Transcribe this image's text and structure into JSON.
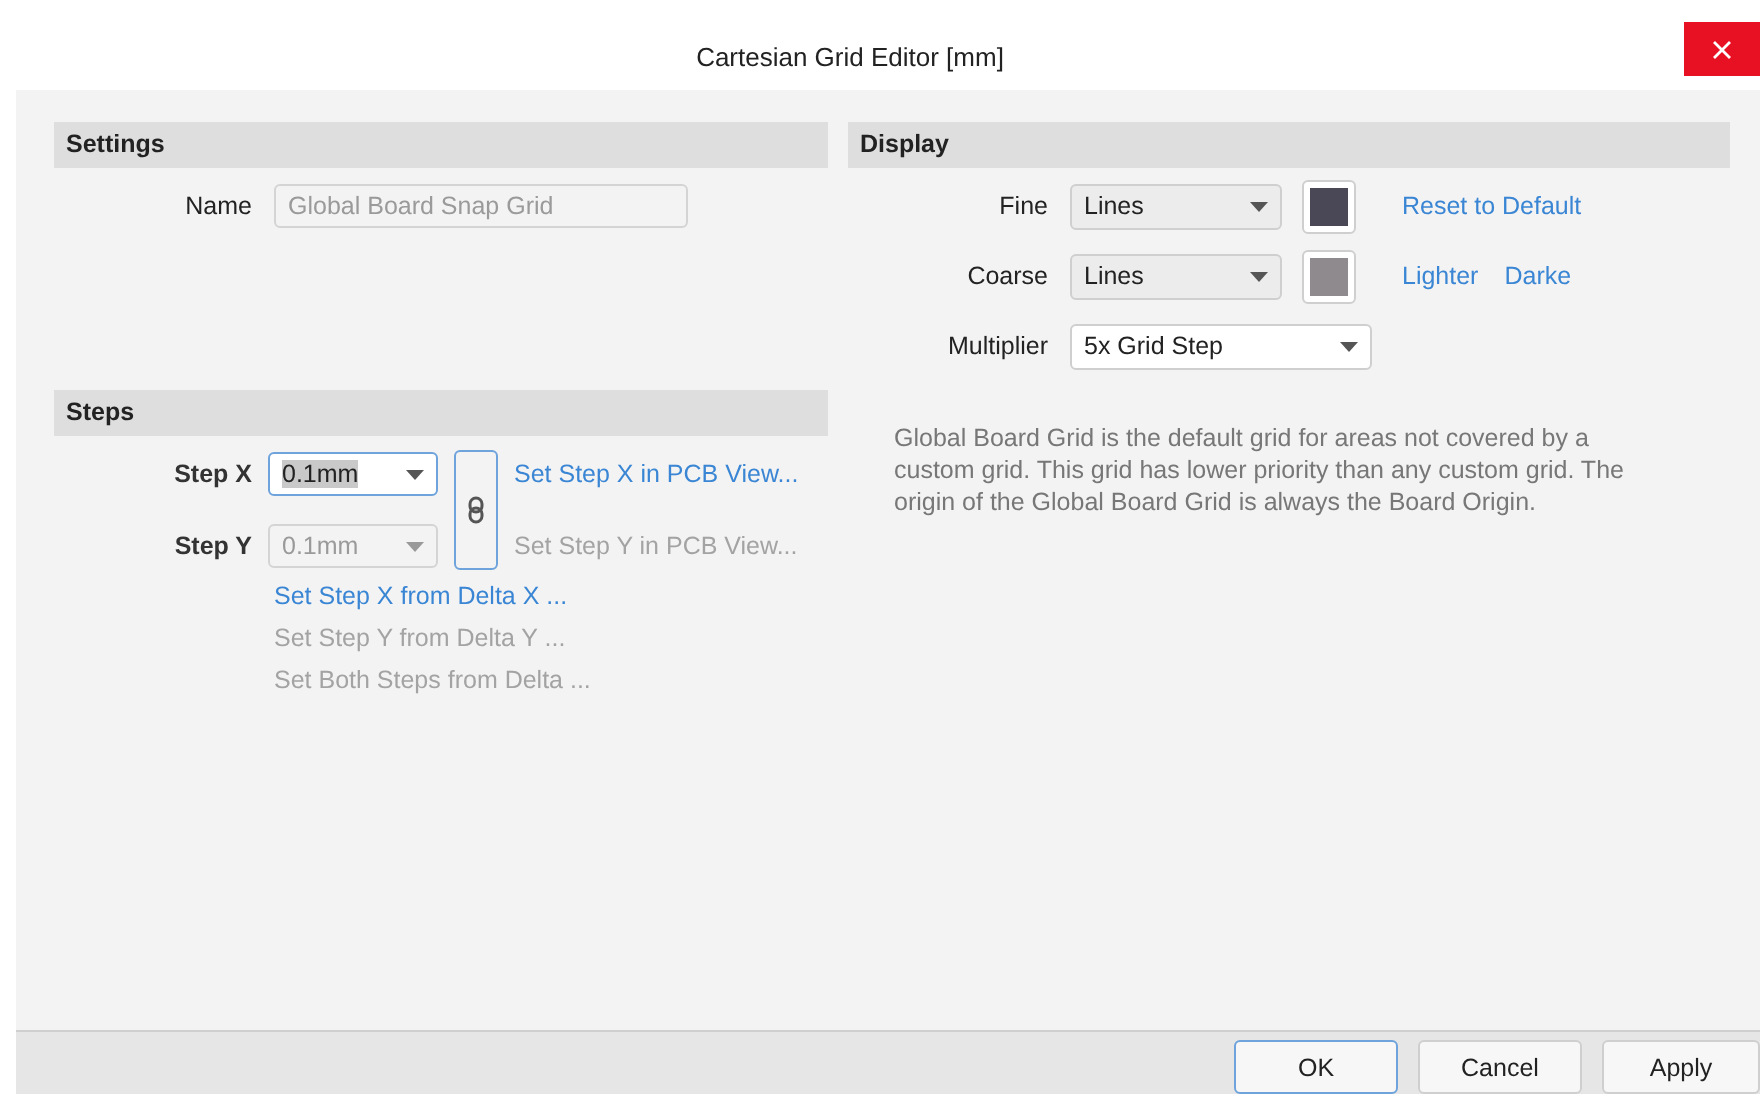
{
  "window": {
    "title": "Cartesian Grid Editor [mm]"
  },
  "settings": {
    "header": "Settings",
    "name_label": "Name",
    "name_value": "Global Board Snap Grid",
    "name_disabled": true
  },
  "steps": {
    "header": "Steps",
    "rows": [
      {
        "label": "Step X",
        "value": "0.1mm",
        "disabled": false,
        "focused": true,
        "link": "Set Step X in PCB View...",
        "link_disabled": false
      },
      {
        "label": "Step Y",
        "value": "0.1mm",
        "disabled": true,
        "focused": false,
        "link": "Set Step Y in PCB View...",
        "link_disabled": true
      }
    ],
    "actions": [
      {
        "label": "Set Step X from Delta X ...",
        "disabled": false
      },
      {
        "label": "Set Step Y from Delta Y ...",
        "disabled": true
      },
      {
        "label": "Set Both Steps from Delta ...",
        "disabled": true
      }
    ]
  },
  "display": {
    "header": "Display",
    "rows": [
      {
        "kind": "grid",
        "label": "Fine",
        "value": "Lines",
        "color": "#4a4857",
        "links": [
          "Reset to Default"
        ]
      },
      {
        "kind": "grid",
        "label": "Coarse",
        "value": "Lines",
        "color": "#8e8a8d",
        "links": [
          "Lighter",
          "Darke"
        ]
      },
      {
        "kind": "select",
        "label": "Multiplier",
        "value": "5x Grid Step"
      }
    ],
    "description": "Global Board Grid is the default grid for areas not covered by a custom grid. This grid has lower priority than any custom grid. The origin of the Global Board Grid is always the Board Origin."
  },
  "buttons": [
    {
      "label": "OK",
      "default": true
    },
    {
      "label": "Cancel",
      "default": false
    },
    {
      "label": "Apply",
      "default": false
    }
  ]
}
